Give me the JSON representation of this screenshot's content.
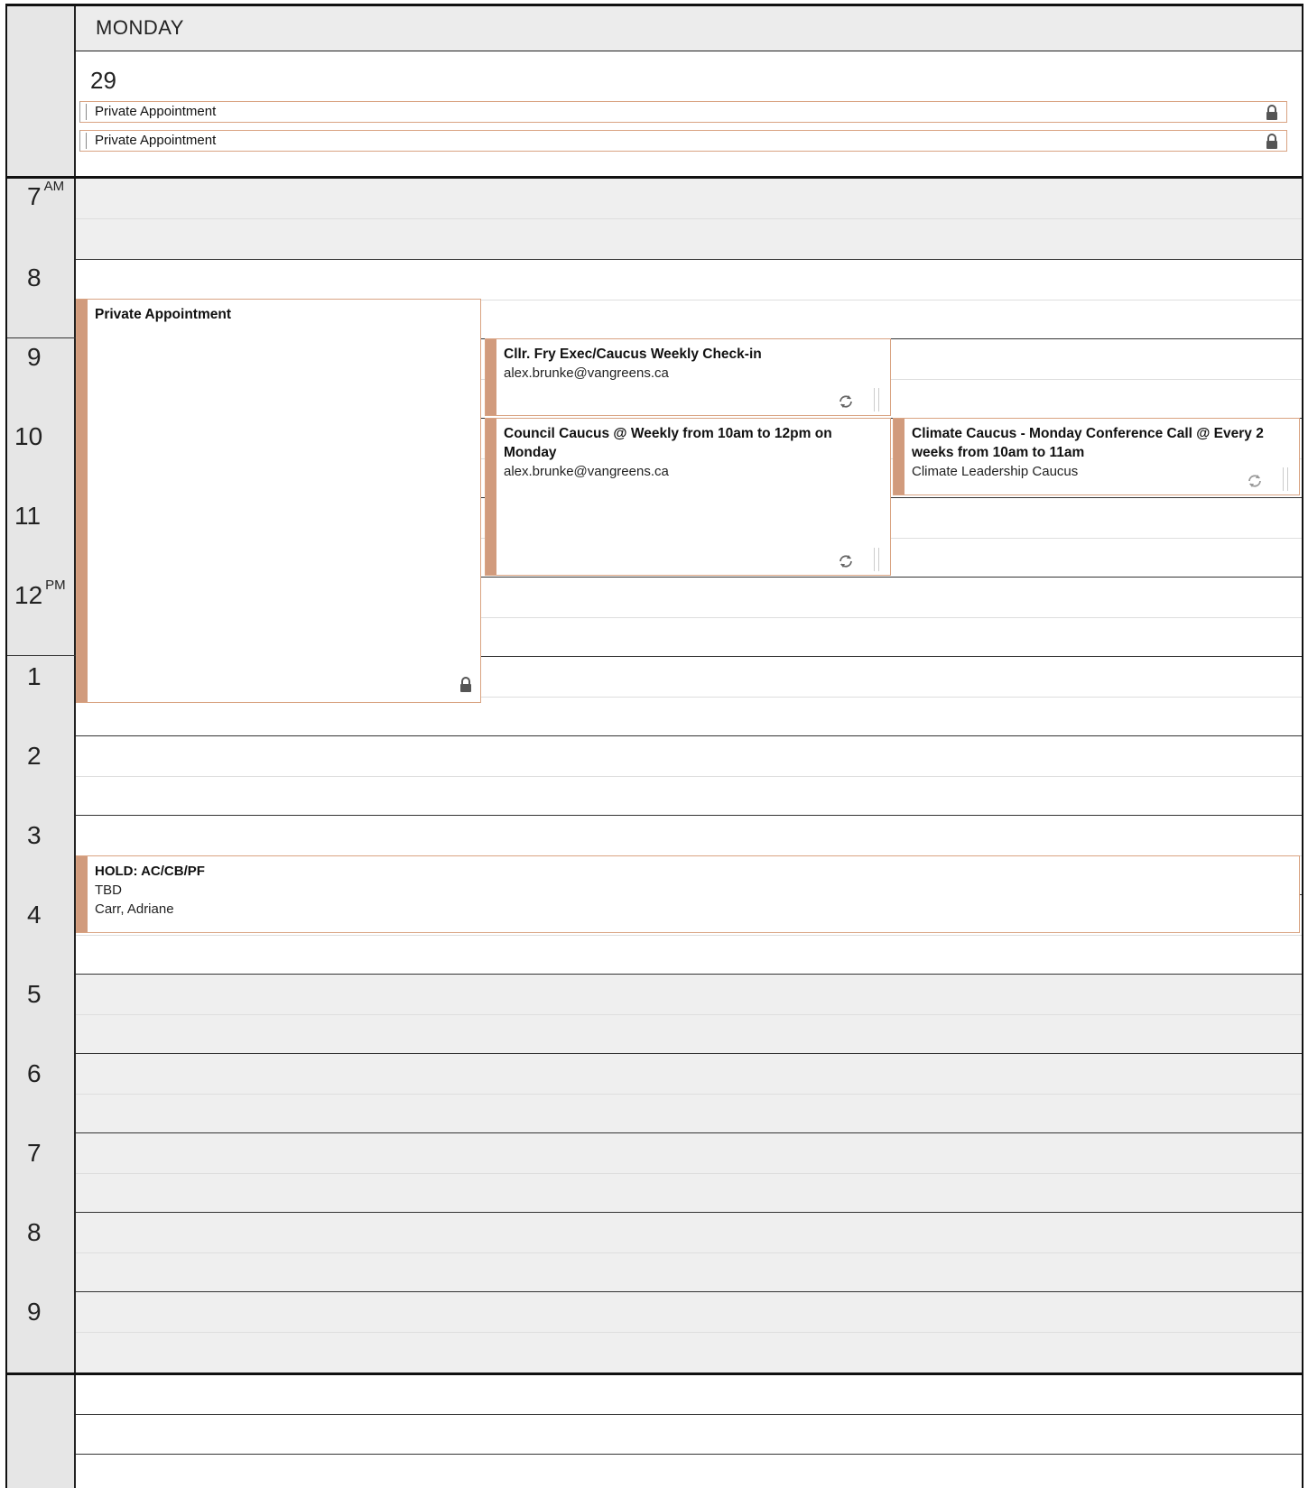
{
  "header": {
    "day_name": "MONDAY",
    "day_number": "29"
  },
  "all_day": [
    {
      "label": "Private Appointment",
      "icon": "lock-icon"
    },
    {
      "label": "Private Appointment",
      "icon": "lock-icon"
    }
  ],
  "hours": [
    {
      "label": "7",
      "suffix": "AM"
    },
    {
      "label": "8",
      "suffix": ""
    },
    {
      "label": "9",
      "suffix": ""
    },
    {
      "label": "10",
      "suffix": ""
    },
    {
      "label": "11",
      "suffix": ""
    },
    {
      "label": "12",
      "suffix": "PM"
    },
    {
      "label": "1",
      "suffix": ""
    },
    {
      "label": "2",
      "suffix": ""
    },
    {
      "label": "3",
      "suffix": ""
    },
    {
      "label": "4",
      "suffix": ""
    },
    {
      "label": "5",
      "suffix": ""
    },
    {
      "label": "6",
      "suffix": ""
    },
    {
      "label": "7",
      "suffix": ""
    },
    {
      "label": "8",
      "suffix": ""
    },
    {
      "label": "9",
      "suffix": ""
    }
  ],
  "appointments": {
    "private": {
      "title": "Private Appointment",
      "icon": "lock-icon"
    },
    "fry": {
      "title": "Cllr. Fry Exec/Caucus Weekly Check-in",
      "line2": "alex.brunke@vangreens.ca",
      "icon": "recurring-icon"
    },
    "council": {
      "title_a": "Council Caucus @ Weekly from 10am to 12pm on",
      "title_b": "Monday",
      "line2": "alex.brunke@vangreens.ca",
      "icon": "recurring-icon"
    },
    "climate": {
      "title_a": "Climate Caucus - Monday Conference Call @ Every 2",
      "title_b": "weeks from 10am to 11am",
      "line2": "Climate Leadership Caucus",
      "icon": "recurring-icon"
    },
    "hold": {
      "title": "HOLD: AC/CB/PF",
      "line2": "TBD",
      "line3": "Carr, Adriane"
    }
  },
  "colors": {
    "accent": "#d19b7d",
    "accent_border": "#d9a382",
    "off_hours": "#efefef",
    "time_column": "#e6e6e6"
  }
}
